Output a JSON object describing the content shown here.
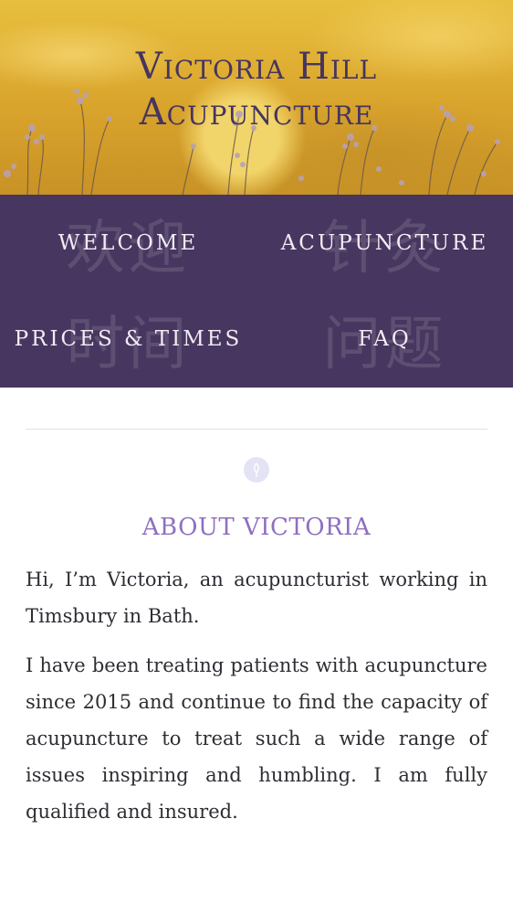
{
  "hero": {
    "title_line1": "Victoria Hill",
    "title_line2": "Acupuncture"
  },
  "nav": {
    "items": [
      {
        "label": "WELCOME",
        "bg": "欢迎"
      },
      {
        "label": "ACUPUNCTURE",
        "bg": "针灸"
      },
      {
        "label": "PRICES & TIMES",
        "bg": "时间"
      },
      {
        "label": "FAQ",
        "bg": "问题"
      }
    ]
  },
  "about": {
    "heading": "ABOUT VICTORIA",
    "paragraphs": [
      "Hi, I’m Victoria, an acupuncturist working in Timsbury in Bath.",
      "I have been treating patients with acupuncture since 2015 and continue to find the capacity of acupuncture to treat such a wide range of issues inspiring and humbling. I am fully qualified and insured."
    ]
  },
  "colors": {
    "nav_bg": "#47365f",
    "accent": "#8f6fc0",
    "hero": "#d9a42c"
  },
  "icons": {
    "section": "leaf-icon"
  }
}
